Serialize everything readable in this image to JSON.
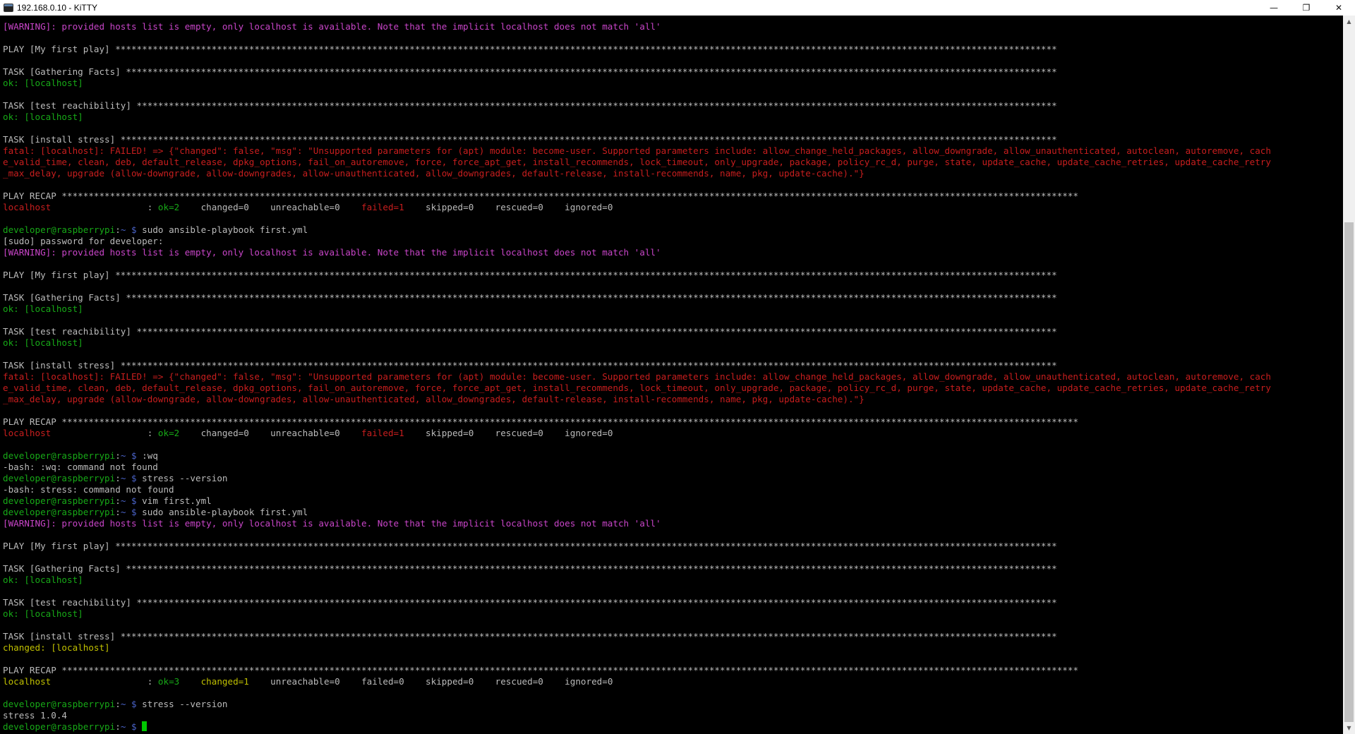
{
  "window": {
    "title": "192.168.0.10 - KiTTY",
    "controls": {
      "minimize": "—",
      "restore": "❐",
      "close": "✕"
    }
  },
  "colors": {
    "background": "#000000",
    "default_text": "#bbbbbb",
    "warning": "#c845c8",
    "ok": "#17a917",
    "error": "#c81e1e",
    "changed": "#c0c000",
    "prompt_user": "#17a917",
    "prompt_dir": "#4a63c8",
    "cursor": "#00c800"
  },
  "scrollbar": {
    "position": 0.28,
    "visible_fraction": 0.72
  },
  "terminal": {
    "lines": [
      [
        {
          "t": "[WARNING]: provided hosts list is empty, only localhost is available. Note that the implicit localhost does not match 'all'",
          "c": "warn"
        }
      ],
      [],
      [
        {
          "t": "PLAY [My first play] ********************************************************************************************************************************************************************************"
        }
      ],
      [],
      [
        {
          "t": "TASK [Gathering Facts] ******************************************************************************************************************************************************************************"
        }
      ],
      [
        {
          "t": "ok: [localhost]",
          "c": "green"
        }
      ],
      [],
      [
        {
          "t": "TASK [test reachibility] ****************************************************************************************************************************************************************************"
        }
      ],
      [
        {
          "t": "ok: [localhost]",
          "c": "green"
        }
      ],
      [],
      [
        {
          "t": "TASK [install stress] *******************************************************************************************************************************************************************************"
        }
      ],
      [
        {
          "t": "fatal: [localhost]: FAILED! => {\"changed\": false, \"msg\": \"Unsupported parameters for (apt) module: become-user. Supported parameters include: allow_change_held_packages, allow_downgrade, allow_unauthenticated, autoclean, autoremove, cach",
          "c": "red"
        }
      ],
      [
        {
          "t": "e_valid_time, clean, deb, default_release, dpkg_options, fail_on_autoremove, force, force_apt_get, install_recommends, lock_timeout, only_upgrade, package, policy_rc_d, purge, state, update_cache, update_cache_retries, update_cache_retry",
          "c": "red"
        }
      ],
      [
        {
          "t": "_max_delay, upgrade (allow-downgrade, allow-downgrades, allow-unauthenticated, allow_downgrades, default-release, install-recommends, name, pkg, update-cache).\"}",
          "c": "red"
        }
      ],
      [],
      [
        {
          "t": "PLAY RECAP **********************************************************************************************************************************************************************************************"
        }
      ],
      [
        {
          "t": "localhost",
          "c": "red"
        },
        {
          "t": "                  : "
        },
        {
          "t": "ok=2",
          "c": "green"
        },
        {
          "t": "    changed=0    unreachable=0    "
        },
        {
          "t": "failed=1",
          "c": "red"
        },
        {
          "t": "    skipped=0    rescued=0    ignored=0"
        }
      ],
      [],
      [
        {
          "t": "developer@raspberrypi",
          "c": "prompt"
        },
        {
          "t": ":"
        },
        {
          "t": "~",
          "c": "blue"
        },
        {
          "t": " $ ",
          "c": "blue"
        },
        {
          "t": "sudo ansible-playbook first.yml"
        }
      ],
      [
        {
          "t": "[sudo] password for developer:"
        }
      ],
      [
        {
          "t": "[WARNING]: provided hosts list is empty, only localhost is available. Note that the implicit localhost does not match 'all'",
          "c": "warn"
        }
      ],
      [],
      [
        {
          "t": "PLAY [My first play] ********************************************************************************************************************************************************************************"
        }
      ],
      [],
      [
        {
          "t": "TASK [Gathering Facts] ******************************************************************************************************************************************************************************"
        }
      ],
      [
        {
          "t": "ok: [localhost]",
          "c": "green"
        }
      ],
      [],
      [
        {
          "t": "TASK [test reachibility] ****************************************************************************************************************************************************************************"
        }
      ],
      [
        {
          "t": "ok: [localhost]",
          "c": "green"
        }
      ],
      [],
      [
        {
          "t": "TASK [install stress] *******************************************************************************************************************************************************************************"
        }
      ],
      [
        {
          "t": "fatal: [localhost]: FAILED! => {\"changed\": false, \"msg\": \"Unsupported parameters for (apt) module: become-user. Supported parameters include: allow_change_held_packages, allow_downgrade, allow_unauthenticated, autoclean, autoremove, cach",
          "c": "red"
        }
      ],
      [
        {
          "t": "e_valid_time, clean, deb, default_release, dpkg_options, fail_on_autoremove, force, force_apt_get, install_recommends, lock_timeout, only_upgrade, package, policy_rc_d, purge, state, update_cache, update_cache_retries, update_cache_retry",
          "c": "red"
        }
      ],
      [
        {
          "t": "_max_delay, upgrade (allow-downgrade, allow-downgrades, allow-unauthenticated, allow_downgrades, default-release, install-recommends, name, pkg, update-cache).\"}",
          "c": "red"
        }
      ],
      [],
      [
        {
          "t": "PLAY RECAP **********************************************************************************************************************************************************************************************"
        }
      ],
      [
        {
          "t": "localhost",
          "c": "red"
        },
        {
          "t": "                  : "
        },
        {
          "t": "ok=2",
          "c": "green"
        },
        {
          "t": "    changed=0    unreachable=0    "
        },
        {
          "t": "failed=1",
          "c": "red"
        },
        {
          "t": "    skipped=0    rescued=0    ignored=0"
        }
      ],
      [],
      [
        {
          "t": "developer@raspberrypi",
          "c": "prompt"
        },
        {
          "t": ":"
        },
        {
          "t": "~",
          "c": "blue"
        },
        {
          "t": " $ ",
          "c": "blue"
        },
        {
          "t": ":wq"
        }
      ],
      [
        {
          "t": "-bash: :wq: command not found"
        }
      ],
      [
        {
          "t": "developer@raspberrypi",
          "c": "prompt"
        },
        {
          "t": ":"
        },
        {
          "t": "~",
          "c": "blue"
        },
        {
          "t": " $ ",
          "c": "blue"
        },
        {
          "t": "stress --version"
        }
      ],
      [
        {
          "t": "-bash: stress: command not found"
        }
      ],
      [
        {
          "t": "developer@raspberrypi",
          "c": "prompt"
        },
        {
          "t": ":"
        },
        {
          "t": "~",
          "c": "blue"
        },
        {
          "t": " $ ",
          "c": "blue"
        },
        {
          "t": "vim first.yml"
        }
      ],
      [
        {
          "t": "developer@raspberrypi",
          "c": "prompt"
        },
        {
          "t": ":"
        },
        {
          "t": "~",
          "c": "blue"
        },
        {
          "t": " $ ",
          "c": "blue"
        },
        {
          "t": "sudo ansible-playbook first.yml"
        }
      ],
      [
        {
          "t": "[WARNING]: provided hosts list is empty, only localhost is available. Note that the implicit localhost does not match 'all'",
          "c": "warn"
        }
      ],
      [],
      [
        {
          "t": "PLAY [My first play] ********************************************************************************************************************************************************************************"
        }
      ],
      [],
      [
        {
          "t": "TASK [Gathering Facts] ******************************************************************************************************************************************************************************"
        }
      ],
      [
        {
          "t": "ok: [localhost]",
          "c": "green"
        }
      ],
      [],
      [
        {
          "t": "TASK [test reachibility] ****************************************************************************************************************************************************************************"
        }
      ],
      [
        {
          "t": "ok: [localhost]",
          "c": "green"
        }
      ],
      [],
      [
        {
          "t": "TASK [install stress] *******************************************************************************************************************************************************************************"
        }
      ],
      [
        {
          "t": "changed: [localhost]",
          "c": "yellow"
        }
      ],
      [],
      [
        {
          "t": "PLAY RECAP **********************************************************************************************************************************************************************************************"
        }
      ],
      [
        {
          "t": "localhost",
          "c": "yellow"
        },
        {
          "t": "                  : "
        },
        {
          "t": "ok=3",
          "c": "green"
        },
        {
          "t": "    "
        },
        {
          "t": "changed=1",
          "c": "yellow"
        },
        {
          "t": "    unreachable=0    failed=0    skipped=0    rescued=0    ignored=0"
        }
      ],
      [],
      [
        {
          "t": "developer@raspberrypi",
          "c": "prompt"
        },
        {
          "t": ":"
        },
        {
          "t": "~",
          "c": "blue"
        },
        {
          "t": " $ ",
          "c": "blue"
        },
        {
          "t": "stress --version"
        }
      ],
      [
        {
          "t": "stress 1.0.4"
        }
      ],
      [
        {
          "t": "developer@raspberrypi",
          "c": "prompt"
        },
        {
          "t": ":"
        },
        {
          "t": "~",
          "c": "blue"
        },
        {
          "t": " $ ",
          "c": "blue"
        }
      ]
    ]
  }
}
